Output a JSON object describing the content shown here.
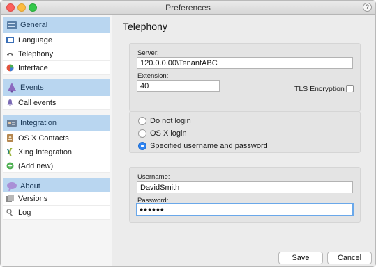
{
  "window": {
    "title": "Preferences",
    "help_label": "?"
  },
  "sidebar": {
    "sections": [
      {
        "label": "General",
        "icon": "general-icon",
        "items": [
          {
            "label": "Language",
            "icon": "language-icon"
          },
          {
            "label": "Telephony",
            "icon": "telephony-icon"
          },
          {
            "label": "Interface",
            "icon": "interface-icon"
          }
        ]
      },
      {
        "label": "Events",
        "icon": "events-icon",
        "items": [
          {
            "label": "Call events",
            "icon": "bell-icon"
          }
        ]
      },
      {
        "label": "Integration",
        "icon": "integration-icon",
        "items": [
          {
            "label": "OS X Contacts",
            "icon": "contacts-icon"
          },
          {
            "label": "Xing Integration",
            "icon": "xing-icon"
          },
          {
            "label": "(Add new)",
            "icon": "add-icon"
          }
        ]
      },
      {
        "label": "About",
        "icon": "about-icon",
        "items": [
          {
            "label": "Versions",
            "icon": "versions-icon"
          },
          {
            "label": "Log",
            "icon": "log-icon"
          }
        ]
      }
    ]
  },
  "main": {
    "title": "Telephony",
    "server": {
      "label": "Server:",
      "value": "120.0.0.00\\TenantABC"
    },
    "extension": {
      "label": "Extension:",
      "value": "40"
    },
    "tls": {
      "label": "TLS Encryption",
      "checked": false
    },
    "login_options": [
      {
        "label": "Do not login",
        "selected": false
      },
      {
        "label": "OS X login",
        "selected": false
      },
      {
        "label": "Specified username and password",
        "selected": true
      }
    ],
    "username": {
      "label": "Username:",
      "value": "DavidSmith"
    },
    "password": {
      "label": "Password:",
      "value": "●●●●●●"
    }
  },
  "footer": {
    "save_label": "Save",
    "cancel_label": "Cancel"
  },
  "colors": {
    "accent": "#2f84f2",
    "section_header": "#b9d6f0",
    "focus_ring": "#6aa8ea"
  }
}
